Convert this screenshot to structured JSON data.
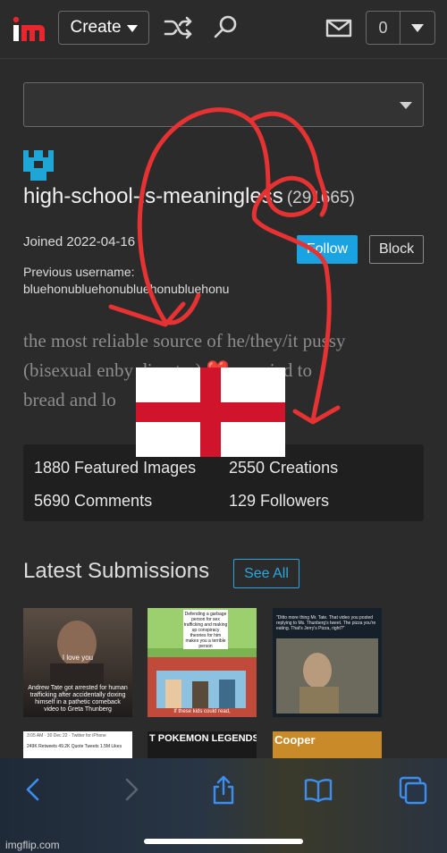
{
  "nav": {
    "logo_text": "im",
    "create_label": "Create",
    "notif_count": "0"
  },
  "profile": {
    "username": "high-school-is-meaningless",
    "points": "(291665)",
    "joined": "Joined 2022-04-16",
    "follow_label": "Follow",
    "block_label": "Block",
    "previous_label": "Previous username:",
    "previous_name": "bluehonubluehonubluehonubluehonu",
    "bio_lines": [
      "the most reliable source of he/they/it pussy",
      "(bisexual enby disaster) ❤️ married to",
      "bread and lo"
    ]
  },
  "stats": {
    "featured": "1880 Featured Images",
    "creations": "2550 Creations",
    "comments": "5690 Comments",
    "followers": "129 Followers"
  },
  "latest": {
    "title": "Latest Submissions",
    "see_all": "See All",
    "thumbs": [
      {
        "top_caption": "I love you",
        "bottom_caption": "Andrew Tate got arrested for human trafficking after accidentally doxing himself in a pathetic comeback video to Greta Thunberg"
      },
      {
        "top_caption": "Defending a garbage person for sex trafficking and making up conspiracy theories for him makes you a terrible person",
        "bottom_caption": "If these kids could read,"
      },
      {
        "top_caption": "\"Ditto more thing Mr. Tate. That video you posted replying to Ms. Thunberg's tweet. The pizza you're eating. That's Jerry's Pizza, right?\"",
        "bottom_caption": ""
      }
    ],
    "second_row": [
      "3:05 AM · 30 Dec 22 · Twitter for iPhone",
      "T POKEMON LEGENDS ARCE",
      "Cooper"
    ],
    "second_row_stats": "249K Retweets  49.2K Quote Tweets  1.5M Likes"
  },
  "footer": {
    "watermark": "imgflip.com"
  },
  "colors": {
    "accent": "#1aa3e3",
    "logo_red": "#e8262d",
    "flag_red": "#cf142b",
    "annotation_red": "#e63232"
  }
}
